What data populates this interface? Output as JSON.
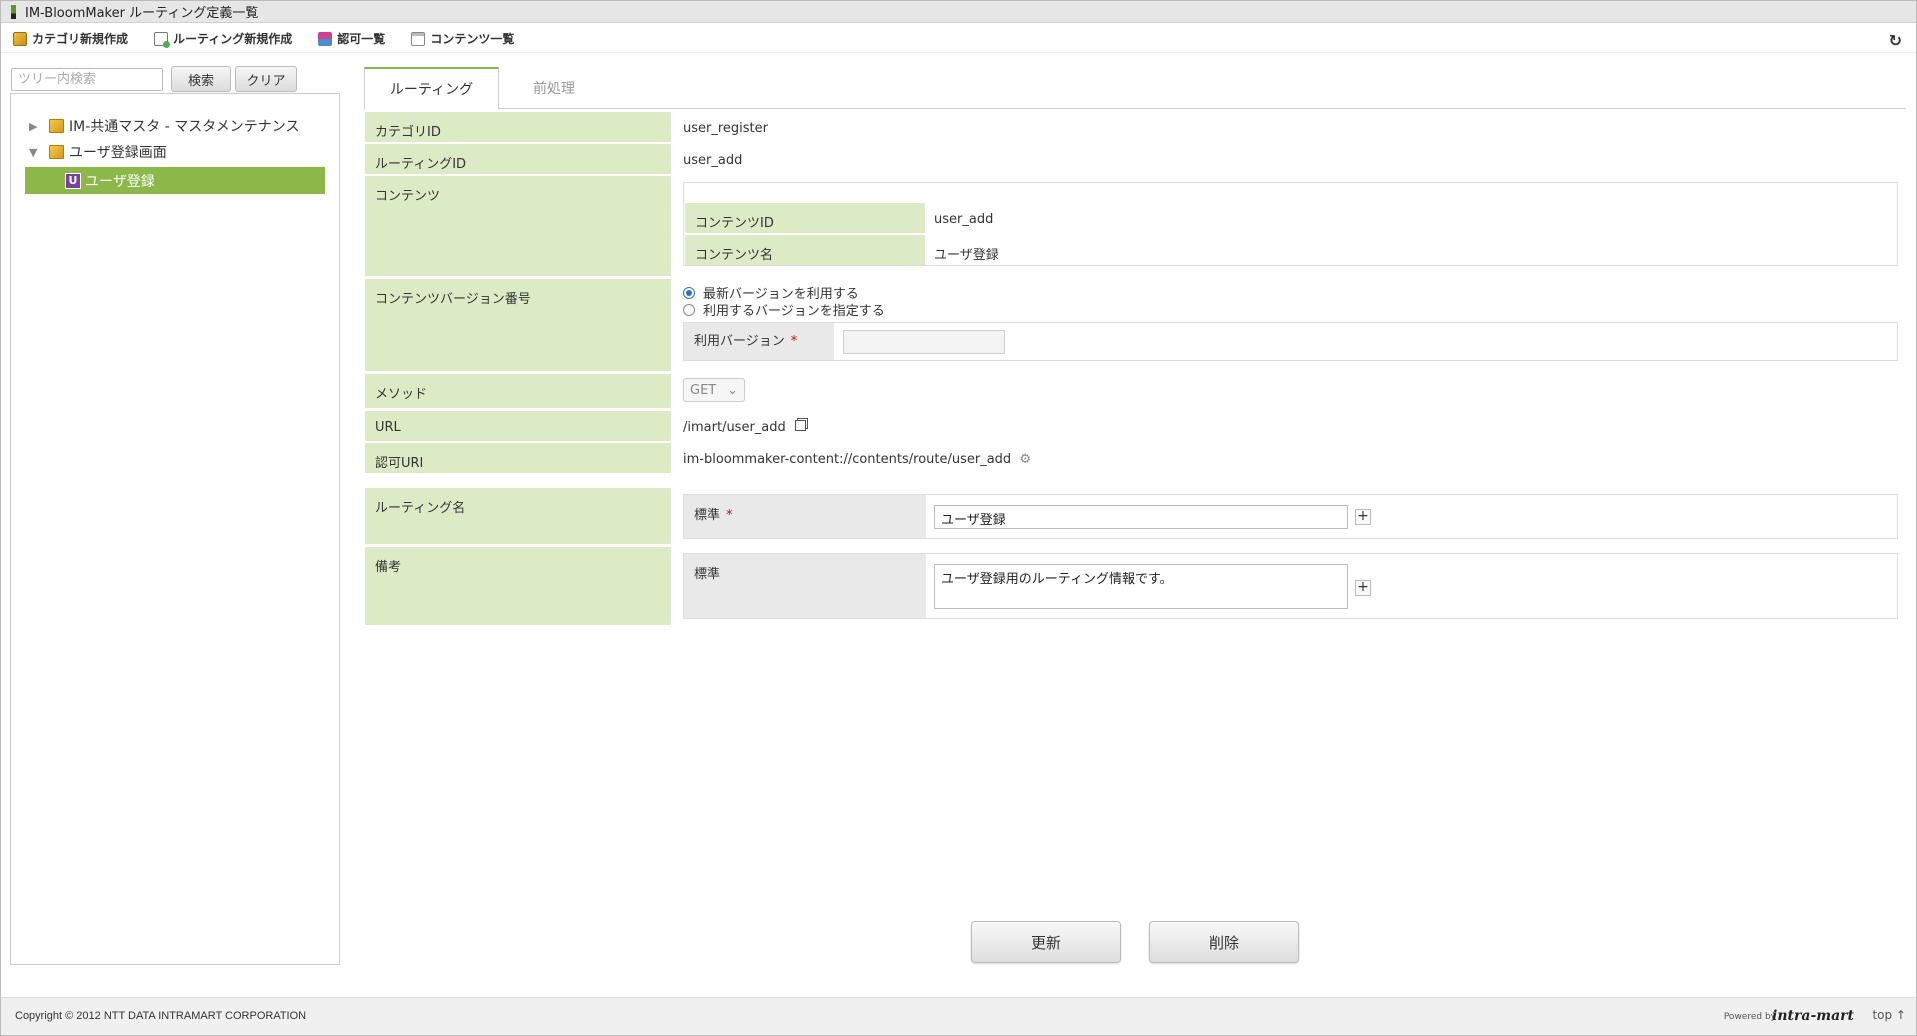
{
  "window": {
    "title": "IM-BloomMaker ルーティング定義一覧"
  },
  "toolbar": {
    "items": [
      {
        "label": "カテゴリ新規作成",
        "icon": "category-folder-icon"
      },
      {
        "label": "ルーティング新規作成",
        "icon": "new-routing-icon"
      },
      {
        "label": "認可一覧",
        "icon": "authorization-icon"
      },
      {
        "label": "コンテンツ一覧",
        "icon": "content-list-icon"
      }
    ],
    "refresh_icon": "refresh-icon"
  },
  "tree": {
    "search_placeholder": "ツリー内検索",
    "search_label": "検索",
    "clear_label": "クリア",
    "nodes": [
      {
        "label": "IM-共通マスタ - マスタメンテナンス",
        "expanded": false
      },
      {
        "label": "ユーザ登録画面",
        "expanded": true
      }
    ],
    "selected_leaf": {
      "badge": "U",
      "label": "ユーザ登録"
    }
  },
  "tabs": [
    {
      "label": "ルーティング",
      "active": true
    },
    {
      "label": "前処理",
      "active": false
    }
  ],
  "form": {
    "category_id": {
      "label": "カテゴリID",
      "value": "user_register"
    },
    "routing_id": {
      "label": "ルーティングID",
      "value": "user_add"
    },
    "content": {
      "label": "コンテンツ",
      "content_id_label": "コンテンツID",
      "content_id": "user_add",
      "content_name_label": "コンテンツ名",
      "content_name": "ユーザ登録"
    },
    "version": {
      "label": "コンテンツバージョン番号",
      "option_latest": "最新バージョンを利用する",
      "option_specify": "利用するバージョンを指定する",
      "selected": "latest",
      "use_version_label": "利用バージョン",
      "required_mark": "*",
      "use_version_value": ""
    },
    "method": {
      "label": "メソッド",
      "value": "GET"
    },
    "url": {
      "label": "URL",
      "value": "/imart/user_add"
    },
    "auth_uri": {
      "label": "認可URI",
      "value": "im-bloommaker-content://contents/route/user_add"
    },
    "routing_name": {
      "label": "ルーティング名",
      "locale_label": "標準",
      "required_mark": "*",
      "value": "ユーザ登録"
    },
    "remarks": {
      "label": "備考",
      "locale_label": "標準",
      "value": "ユーザ登録用のルーティング情報です。"
    }
  },
  "actions": {
    "update_label": "更新",
    "delete_label": "削除"
  },
  "footer": {
    "copyright": "Copyright © 2012 NTT DATA INTRAMART CORPORATION",
    "powered_by": "Powered by",
    "logo_text": "intra-mart",
    "top_link": "top ↑"
  },
  "colors": {
    "accent": "#8cb84a",
    "label_bg": "#dcebc5",
    "required": "#d0021b"
  }
}
